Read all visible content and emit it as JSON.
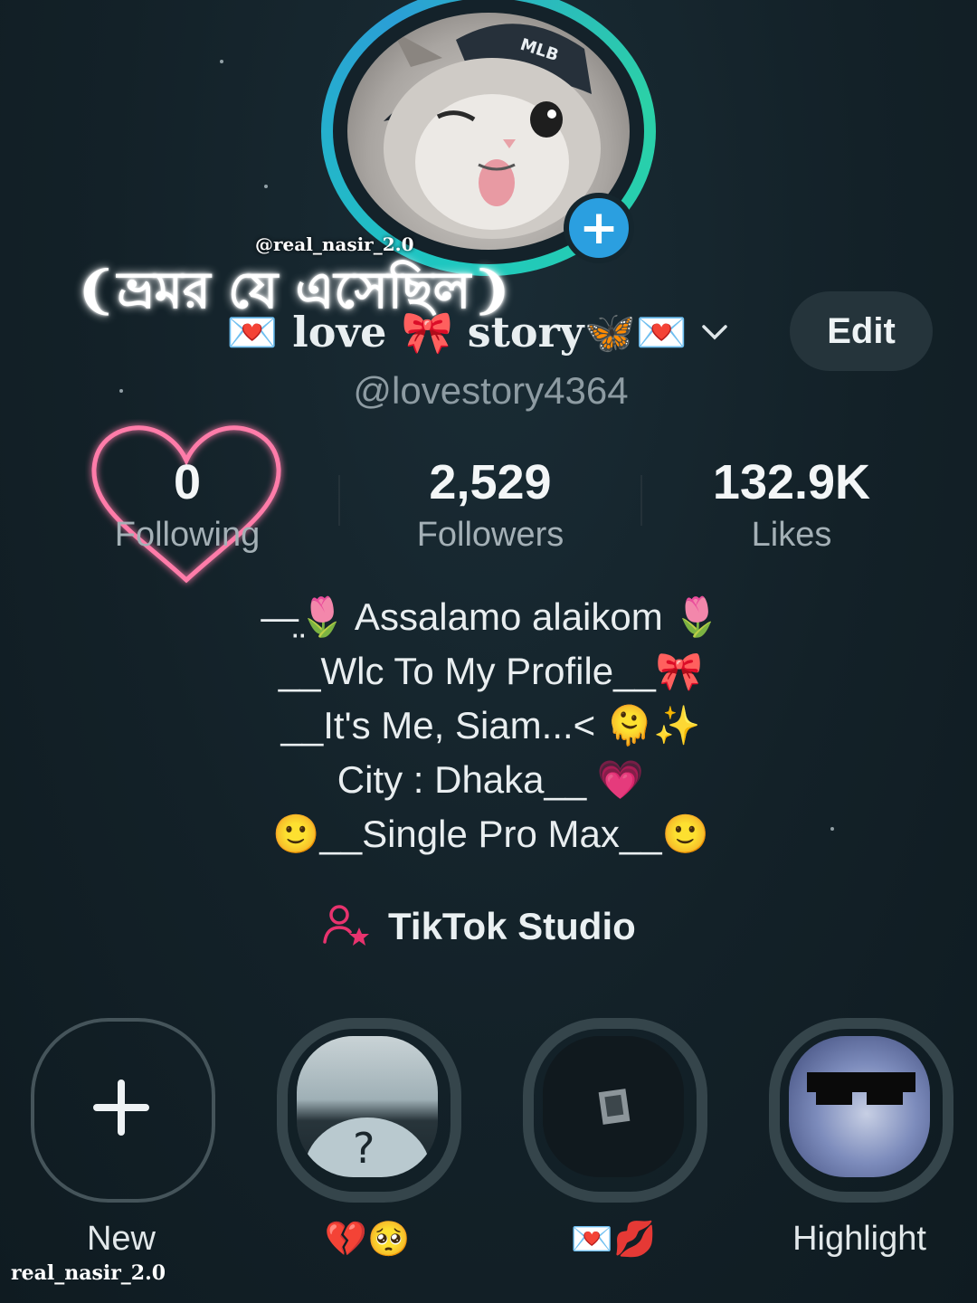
{
  "overlay": {
    "watermark_top": "@real_nasir_2.0",
    "title_bangla": "❨ভ্রমর যে এসেছিল❩",
    "watermark_bottom": "real_nasir_2.0"
  },
  "profile": {
    "display_name": "💌 love 🎀 story🦋💌",
    "handle": "@lovestory4364",
    "edit_label": "Edit",
    "avatar_badge_icon": "plus-icon"
  },
  "stats": {
    "following": {
      "value": "0",
      "label": "Following"
    },
    "followers": {
      "value": "2,529",
      "label": "Followers"
    },
    "likes": {
      "value": "132.9K",
      "label": "Likes"
    }
  },
  "bio": {
    "lines": [
      "—̤̤🌷 Assalamo alaikom 🌷",
      "__Wlc To My Profile__🎀",
      "__It's Me, Siam...< 🫠✨",
      "City : Dhaka__ 💗",
      "🙂__Single Pro Max__🙂"
    ]
  },
  "studio": {
    "label": "TikTok Studio",
    "icon": "creator-star-icon",
    "color": "#e8336e"
  },
  "highlights": [
    {
      "label": "New",
      "icon": "plus-icon"
    },
    {
      "label": "💔🥺"
    },
    {
      "label": "💌💋"
    },
    {
      "label": "Highlight"
    }
  ],
  "colors": {
    "background": "#14222a",
    "avatar_ring": "#1ec7c0",
    "badge": "#2b9fe0",
    "heart_glow": "#ff4f8b"
  }
}
